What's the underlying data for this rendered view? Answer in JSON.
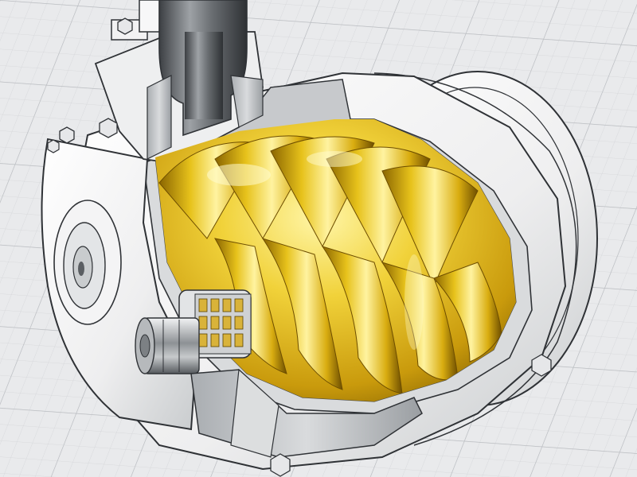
{
  "image": {
    "subject": "screw-compressor-cutaway",
    "colors": {
      "background": "#e9eaec",
      "grid_minor": "#d3d5d8",
      "grid_major": "#b9bcc0",
      "housing_light": "#f7f7f7",
      "housing_mid": "#cfd1d3",
      "housing_dark": "#8e9296",
      "outline": "#2f3236",
      "rotor_highlight": "#fff6a8",
      "rotor_gold": "#e8c21c",
      "rotor_shadow": "#7a5a00",
      "bearing_gold": "#d9b33a"
    }
  }
}
